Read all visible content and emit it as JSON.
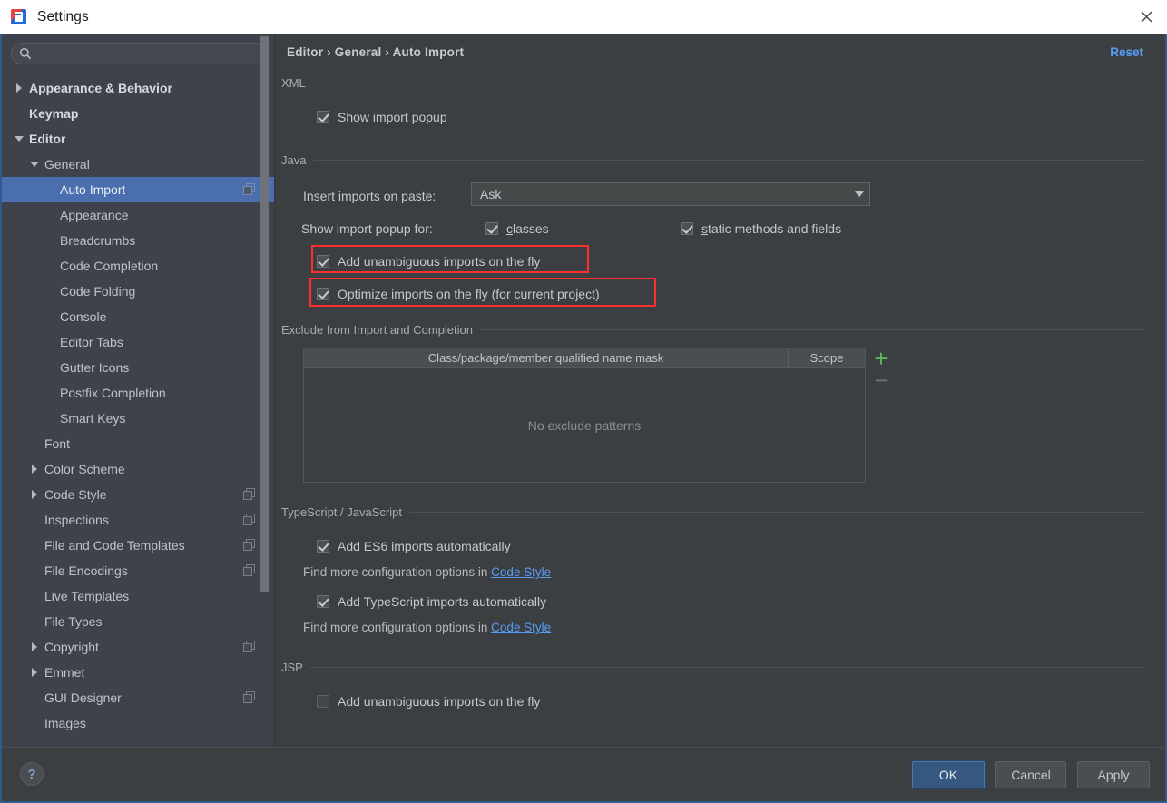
{
  "window": {
    "title": "Settings",
    "app_icon": "intellij-idea-icon",
    "close_icon": "close-icon"
  },
  "sidebar": {
    "search": {
      "value": "",
      "placeholder": "",
      "icon": "search-icon"
    },
    "items": [
      {
        "label": "Appearance & Behavior",
        "indent": 0,
        "twisty": "closed",
        "bold": true,
        "selected": false,
        "badge": false
      },
      {
        "label": "Keymap",
        "indent": 0,
        "twisty": "none",
        "bold": true,
        "selected": false,
        "badge": false
      },
      {
        "label": "Editor",
        "indent": 0,
        "twisty": "open",
        "bold": true,
        "selected": false,
        "badge": false
      },
      {
        "label": "General",
        "indent": 1,
        "twisty": "open",
        "bold": false,
        "selected": false,
        "badge": false
      },
      {
        "label": "Auto Import",
        "indent": 2,
        "twisty": "none",
        "bold": false,
        "selected": true,
        "badge": true
      },
      {
        "label": "Appearance",
        "indent": 2,
        "twisty": "none",
        "bold": false,
        "selected": false,
        "badge": false
      },
      {
        "label": "Breadcrumbs",
        "indent": 2,
        "twisty": "none",
        "bold": false,
        "selected": false,
        "badge": false
      },
      {
        "label": "Code Completion",
        "indent": 2,
        "twisty": "none",
        "bold": false,
        "selected": false,
        "badge": false
      },
      {
        "label": "Code Folding",
        "indent": 2,
        "twisty": "none",
        "bold": false,
        "selected": false,
        "badge": false
      },
      {
        "label": "Console",
        "indent": 2,
        "twisty": "none",
        "bold": false,
        "selected": false,
        "badge": false
      },
      {
        "label": "Editor Tabs",
        "indent": 2,
        "twisty": "none",
        "bold": false,
        "selected": false,
        "badge": false
      },
      {
        "label": "Gutter Icons",
        "indent": 2,
        "twisty": "none",
        "bold": false,
        "selected": false,
        "badge": false
      },
      {
        "label": "Postfix Completion",
        "indent": 2,
        "twisty": "none",
        "bold": false,
        "selected": false,
        "badge": false
      },
      {
        "label": "Smart Keys",
        "indent": 2,
        "twisty": "none",
        "bold": false,
        "selected": false,
        "badge": false
      },
      {
        "label": "Font",
        "indent": 1,
        "twisty": "none",
        "bold": false,
        "selected": false,
        "badge": false
      },
      {
        "label": "Color Scheme",
        "indent": 1,
        "twisty": "closed",
        "bold": false,
        "selected": false,
        "badge": false
      },
      {
        "label": "Code Style",
        "indent": 1,
        "twisty": "closed",
        "bold": false,
        "selected": false,
        "badge": true
      },
      {
        "label": "Inspections",
        "indent": 1,
        "twisty": "none",
        "bold": false,
        "selected": false,
        "badge": true
      },
      {
        "label": "File and Code Templates",
        "indent": 1,
        "twisty": "none",
        "bold": false,
        "selected": false,
        "badge": true
      },
      {
        "label": "File Encodings",
        "indent": 1,
        "twisty": "none",
        "bold": false,
        "selected": false,
        "badge": true
      },
      {
        "label": "Live Templates",
        "indent": 1,
        "twisty": "none",
        "bold": false,
        "selected": false,
        "badge": false
      },
      {
        "label": "File Types",
        "indent": 1,
        "twisty": "none",
        "bold": false,
        "selected": false,
        "badge": false
      },
      {
        "label": "Copyright",
        "indent": 1,
        "twisty": "closed",
        "bold": false,
        "selected": false,
        "badge": true
      },
      {
        "label": "Emmet",
        "indent": 1,
        "twisty": "closed",
        "bold": false,
        "selected": false,
        "badge": false
      },
      {
        "label": "GUI Designer",
        "indent": 1,
        "twisty": "none",
        "bold": false,
        "selected": false,
        "badge": true
      },
      {
        "label": "Images",
        "indent": 1,
        "twisty": "none",
        "bold": false,
        "selected": false,
        "badge": false
      }
    ]
  },
  "content": {
    "breadcrumb": "Editor › General › Auto Import",
    "reset_label": "Reset",
    "xml": {
      "section_title": "XML",
      "show_import_popup": {
        "label": "Show import popup",
        "checked": true
      }
    },
    "java": {
      "section_title": "Java",
      "insert_imports_label": "Insert imports on paste:",
      "insert_imports_value": "Ask",
      "show_popup_for_label": "Show import popup for:",
      "classes": {
        "label": "classes",
        "mnemonic": "c",
        "checked": true
      },
      "static_methods": {
        "label": "static methods and fields",
        "mnemonic": "s",
        "checked": true
      },
      "add_unambiguous": {
        "label": "Add unambiguous imports on the fly",
        "checked": true,
        "highlighted": true
      },
      "optimize_imports": {
        "label": "Optimize imports on the fly (for current project)",
        "checked": true,
        "highlighted": true
      },
      "exclude": {
        "section_title": "Exclude from Import and Completion",
        "columns": [
          "Class/package/member qualified name mask",
          "Scope"
        ],
        "rows": [],
        "empty_text": "No exclude patterns",
        "add_button": "+",
        "remove_button": "−"
      }
    },
    "typescript": {
      "section_title": "TypeScript / JavaScript",
      "add_es6": {
        "label": "Add ES6 imports automatically",
        "checked": true
      },
      "hint_es6_prefix": "Find more configuration options in ",
      "hint_es6_link": "Code Style",
      "add_ts": {
        "label": "Add TypeScript imports automatically",
        "checked": true
      },
      "hint_ts_prefix": "Find more configuration options in ",
      "hint_ts_link": "Code Style"
    },
    "jsp": {
      "section_title": "JSP",
      "add_unambiguous": {
        "label": "Add unambiguous imports on the fly",
        "checked": false
      }
    }
  },
  "footer": {
    "help_label": "?",
    "ok_label": "OK",
    "cancel_label": "Cancel",
    "apply_label": "Apply"
  },
  "colors": {
    "accent_selection": "#4b6eaf",
    "link": "#589df6",
    "highlight_box": "#ff2d2d",
    "add_button": "#5fb85f",
    "panel_bg": "#3c3f41",
    "sidebar_bg": "#3f424a",
    "dialog_border": "#2e5c8a"
  }
}
